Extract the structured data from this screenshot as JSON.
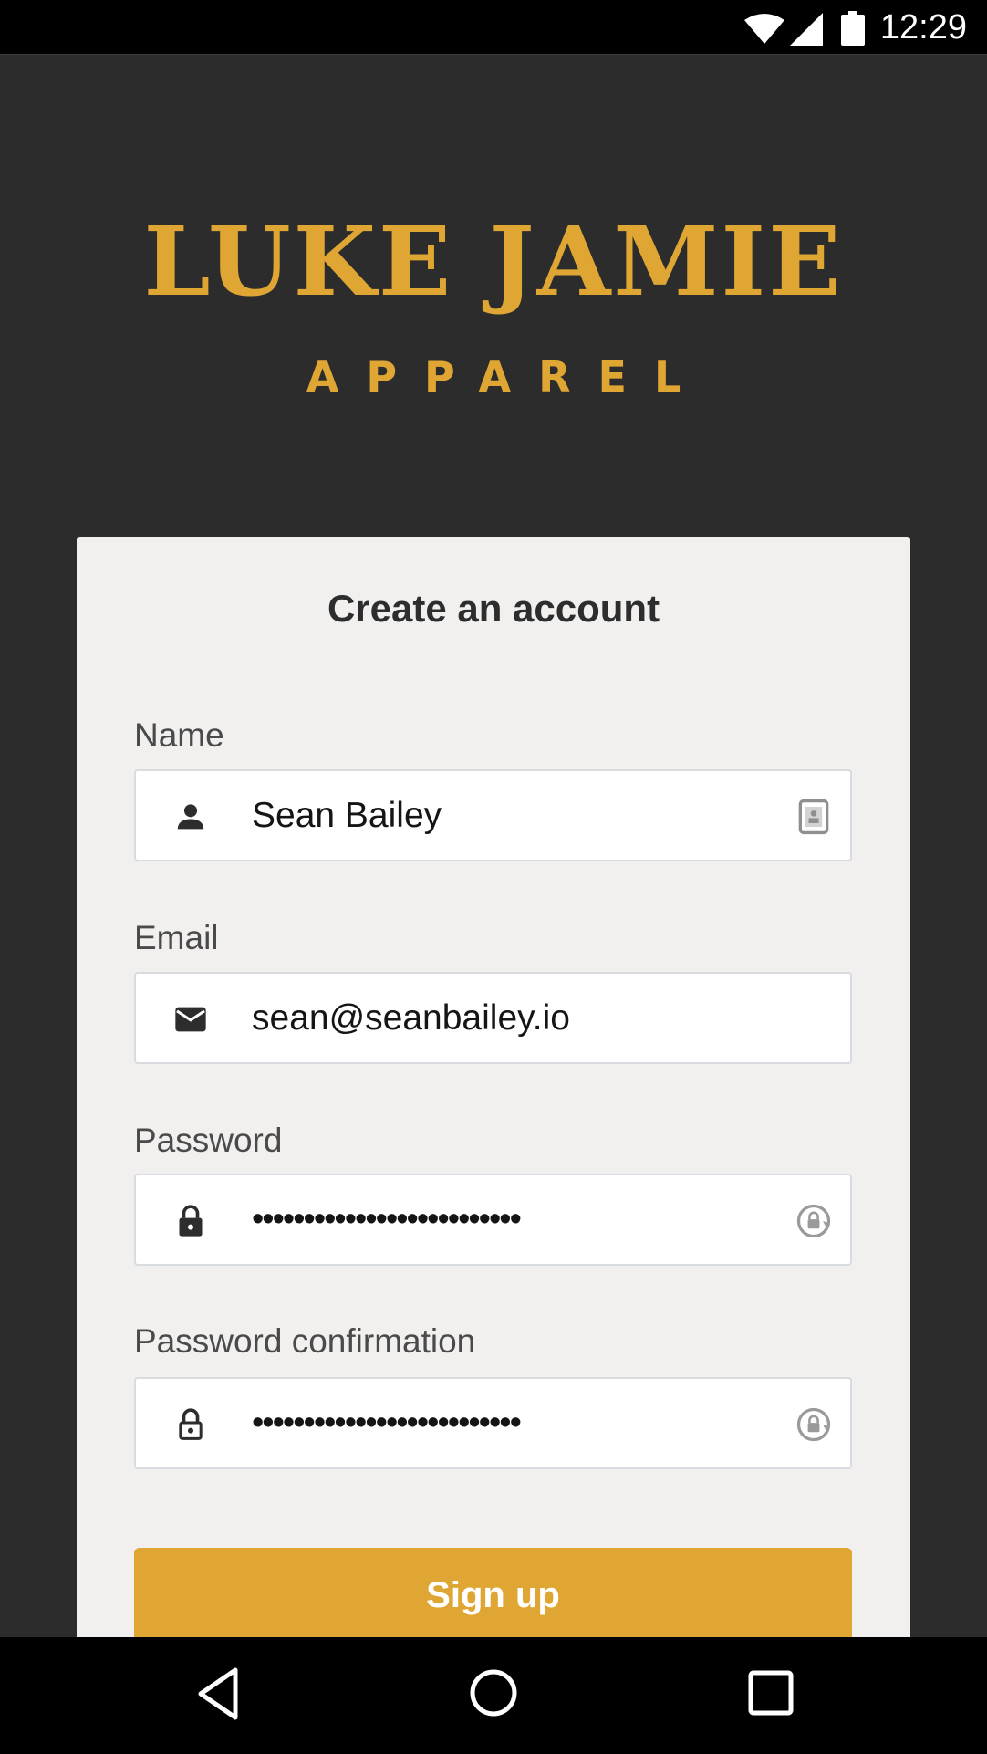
{
  "status_bar": {
    "time": "12:29",
    "icons": [
      "wifi-icon",
      "cellular-signal-icon",
      "battery-icon"
    ]
  },
  "brand": {
    "name": "LUKE JAMIE",
    "subtitle": "APPAREL",
    "color": "#dfa634"
  },
  "form": {
    "title": "Create an account",
    "fields": [
      {
        "label": "Name",
        "value": "Sean Bailey",
        "icon": "person-icon",
        "trailing_icon": "contact-card-icon"
      },
      {
        "label": "Email",
        "value": "sean@seanbailey.io",
        "icon": "envelope-icon"
      },
      {
        "label": "Password",
        "value": "••••••••••••••••••••••••••",
        "icon": "lock-icon",
        "trailing_icon": "password-manager-icon"
      },
      {
        "label": "Password confirmation",
        "value": "••••••••••••••••••••••••••",
        "icon": "lock-outline-icon",
        "trailing_icon": "password-manager-icon"
      }
    ],
    "submit_label": "Sign up"
  },
  "nav_bar": {
    "buttons": [
      "back-icon",
      "home-icon",
      "recents-icon"
    ]
  },
  "colors": {
    "background": "#2c2c2c",
    "card": "#f2f0ef",
    "accent": "#dfa634",
    "field_border": "#d8dbe0"
  }
}
